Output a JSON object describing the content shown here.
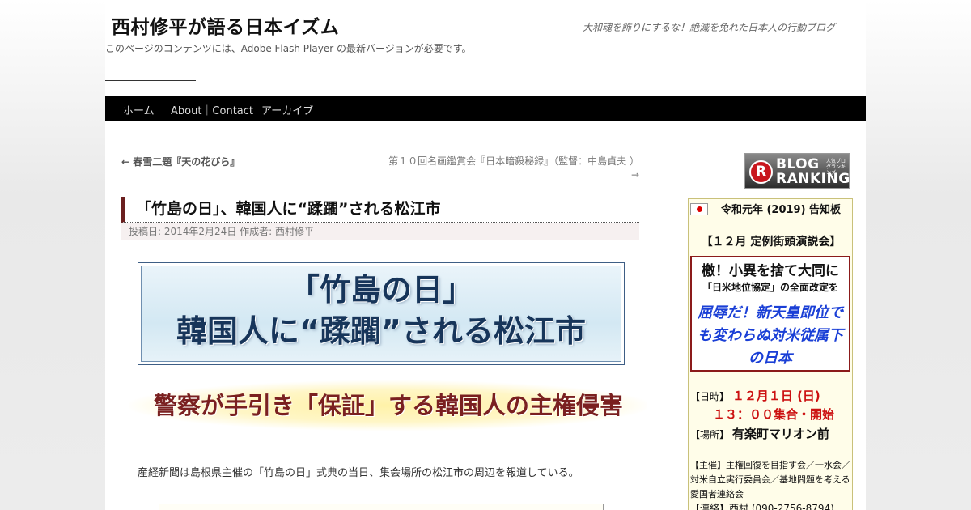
{
  "header": {
    "site_title": "西村修平が語る日本イズム",
    "tagline": "大和魂を飾りにするな！絶滅を免れた日本人の行動ブログ",
    "flash_note": "このページのコンテンツには、Adobe Flash Player の最新バージョンが必要です。"
  },
  "nav": {
    "items": [
      {
        "label": "ホーム"
      },
      {
        "label": "About｜Contact"
      },
      {
        "label": "アーカイブ"
      }
    ]
  },
  "post_nav": {
    "prev": "← 春雪二題『天の花びら』",
    "next_line1": "第１０回名画鑑賞会『日本暗殺秘録』（監督：中島貞夫 ）",
    "next_line2": "→"
  },
  "post": {
    "title": "「竹島の日」、韓国人に“蹂躙”される松江市",
    "meta_posted": "投稿日:",
    "meta_date": "2014年2月24日",
    "meta_author_label": "作成者:",
    "meta_author": "西村修平",
    "banner_line1": "「竹島の日」",
    "banner_line2": "韓国人に“蹂躙”される松江市",
    "subheading": "警察が手引き「保証」する韓国人の主権侵害",
    "body": "産経新聞は島根県主催の「竹島の日」式典の当日、集会場所の松江市の周辺を報道している。"
  },
  "sidebar": {
    "ranking_badge": {
      "icon": "R",
      "line1": "BLOG",
      "line2": "RANKING",
      "small": "人気ブログランキング"
    },
    "notice": {
      "flag_icon": "japan-flag-icon",
      "title": "令和元年 (2019) 告知板",
      "event": "【１２月 定例街頭演説会】",
      "box_line1": "檄！小異を捨て大同に",
      "box_line2": "「日米地位協定」の全面改定を",
      "box_line3": "屈辱だ！新天皇即位でも変わらぬ対米従属下の日本",
      "date_label": "【日時】",
      "date_value": "１２月１日 (日)",
      "time_value": "１３：００集合・開始",
      "place_label": "【場所】",
      "place_value": "有楽町マリオン前",
      "org_label": "【主催】",
      "org_value": "主権回復を目指す会／一水会／対米自立実行委員会／基地問題を考える愛国者連絡会",
      "contact_label": "【連絡】",
      "contact_value": "西村 (090-2756-8794)"
    }
  },
  "colors": {
    "nav_bg": "#000000",
    "title_accent": "#6b1f1f",
    "banner_text": "#17355a",
    "subhead_text": "#7a2020",
    "notice_red": "#cc1111",
    "notice_blue": "#1a3fd6"
  }
}
